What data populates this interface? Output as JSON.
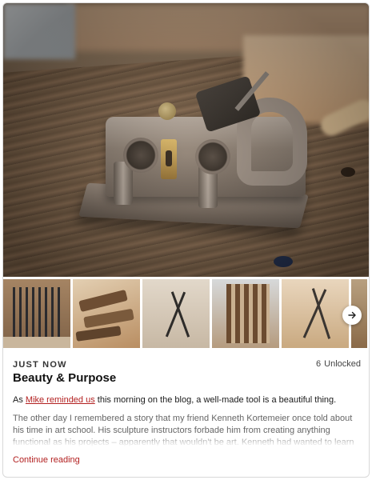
{
  "post": {
    "label": "JUST NOW",
    "unlock_count": "6",
    "unlock_label": "Unlocked",
    "title": "Beauty & Purpose",
    "lead_before": "As ",
    "lead_link": "Mike reminded us",
    "lead_after": " this morning on the blog, a well-made tool is a beautiful thing.",
    "excerpt": "The other day I remembered a story that my friend Kenneth Kortemeier once told about his time in art school. His sculpture instructors forbade him from creating anything functional as his projects – apparently that wouldn't be art. Kenneth had wanted to learn to make a",
    "continue_label": "Continue reading"
  },
  "gallery": {
    "hero_subject": "plow plane on workbench",
    "thumbnails": [
      "carving tools",
      "wooden planes",
      "dividers on board",
      "tool rack",
      "dividers on bench"
    ],
    "next_icon": "arrow-right-icon"
  },
  "colors": {
    "accent": "#b21f1f",
    "muted_text": "#666666"
  }
}
